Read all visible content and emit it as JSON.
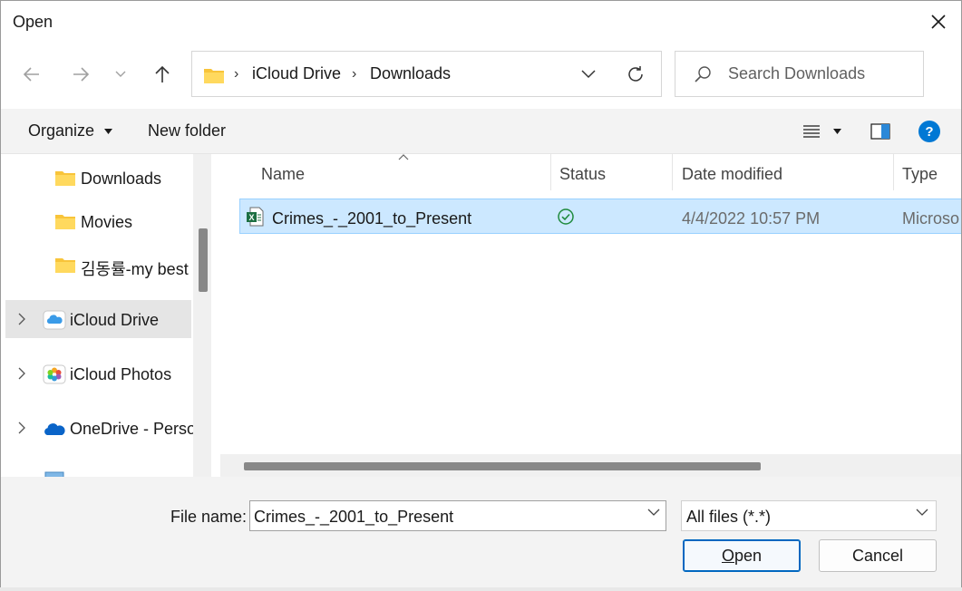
{
  "window": {
    "title": "Open"
  },
  "address": {
    "segments": [
      "iCloud Drive",
      "Downloads"
    ]
  },
  "search": {
    "placeholder": "Search Downloads"
  },
  "toolbar": {
    "organize_label": "Organize",
    "new_folder_label": "New folder"
  },
  "sidebar": {
    "items": [
      {
        "label": "Downloads",
        "icon": "folder-icon"
      },
      {
        "label": "Movies",
        "icon": "folder-icon"
      },
      {
        "label": "김동률-my best",
        "icon": "folder-icon"
      },
      {
        "label": "iCloud Drive",
        "icon": "icloud-icon",
        "selected": true
      },
      {
        "label": "iCloud Photos",
        "icon": "photos-icon"
      },
      {
        "label": "OneDrive - Perso",
        "icon": "onedrive-icon"
      }
    ]
  },
  "columns": {
    "name": "Name",
    "status": "Status",
    "date_modified": "Date modified",
    "type": "Type"
  },
  "files": [
    {
      "name": "Crimes_-_2001_to_Present",
      "status_icon": "synced-check-icon",
      "date_modified": "4/4/2022 10:57 PM",
      "type": "Microso",
      "icon": "excel-file-icon"
    }
  ],
  "footer": {
    "file_name_label": "File name:",
    "file_name_value": "Crimes_-_2001_to_Present",
    "file_type_value": "All files (*.*)",
    "open_label": "Open",
    "cancel_label": "Cancel"
  },
  "colors": {
    "selection": "#cce8ff",
    "accent": "#0067c0",
    "help": "#0078d4",
    "folder": "#f8c43a"
  }
}
